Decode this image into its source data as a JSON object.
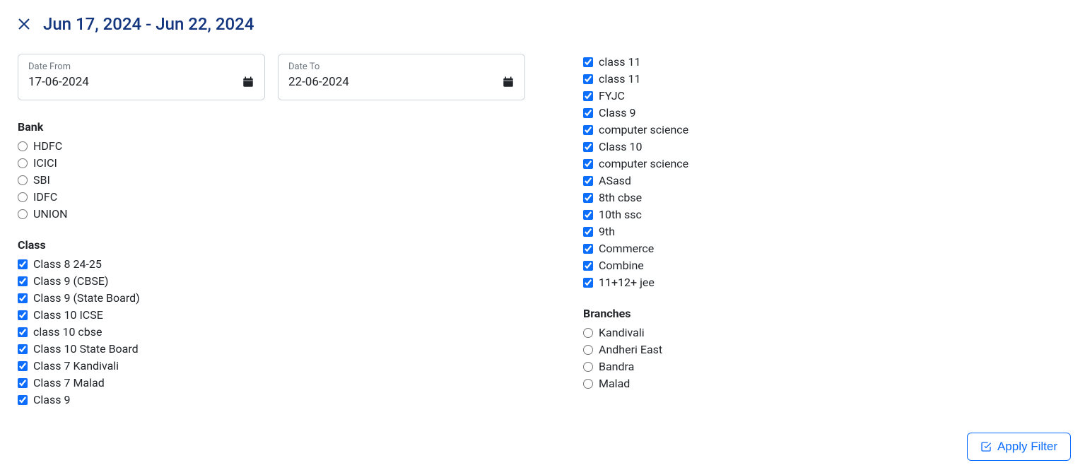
{
  "header": {
    "title": "Jun 17, 2024 - Jun 22, 2024"
  },
  "dateFrom": {
    "label": "Date From",
    "value": "17-06-2024"
  },
  "dateTo": {
    "label": "Date To",
    "value": "22-06-2024"
  },
  "bank": {
    "heading": "Bank",
    "items": [
      {
        "label": "HDFC",
        "checked": false
      },
      {
        "label": "ICICI",
        "checked": false
      },
      {
        "label": "SBI",
        "checked": false
      },
      {
        "label": "IDFC",
        "checked": false
      },
      {
        "label": "UNION",
        "checked": false
      }
    ]
  },
  "classSection": {
    "heading": "Class",
    "itemsLeft": [
      {
        "label": "Class 8 24-25",
        "checked": true
      },
      {
        "label": "Class 9 (CBSE)",
        "checked": true
      },
      {
        "label": "Class 9 (State Board)",
        "checked": true
      },
      {
        "label": "Class 10 ICSE",
        "checked": true
      },
      {
        "label": "class 10 cbse",
        "checked": true
      },
      {
        "label": "Class 10 State Board",
        "checked": true
      },
      {
        "label": "Class 7 Kandivali",
        "checked": true
      },
      {
        "label": "Class 7 Malad",
        "checked": true
      },
      {
        "label": "Class 9",
        "checked": true
      }
    ],
    "itemsRight": [
      {
        "label": "class 11",
        "checked": true
      },
      {
        "label": "class 11",
        "checked": true
      },
      {
        "label": "FYJC",
        "checked": true
      },
      {
        "label": "Class 9",
        "checked": true
      },
      {
        "label": "computer science",
        "checked": true
      },
      {
        "label": "Class 10",
        "checked": true
      },
      {
        "label": "computer science",
        "checked": true
      },
      {
        "label": "ASasd",
        "checked": true
      },
      {
        "label": "8th cbse",
        "checked": true
      },
      {
        "label": "10th ssc",
        "checked": true
      },
      {
        "label": "9th",
        "checked": true
      },
      {
        "label": "Commerce",
        "checked": true
      },
      {
        "label": "Combine",
        "checked": true
      },
      {
        "label": "11+12+ jee",
        "checked": true
      }
    ]
  },
  "branches": {
    "heading": "Branches",
    "items": [
      {
        "label": "Kandivali",
        "checked": false
      },
      {
        "label": "Andheri East",
        "checked": false
      },
      {
        "label": "Bandra",
        "checked": false
      },
      {
        "label": "Malad",
        "checked": false
      }
    ]
  },
  "applyButton": {
    "label": "Apply Filter"
  }
}
